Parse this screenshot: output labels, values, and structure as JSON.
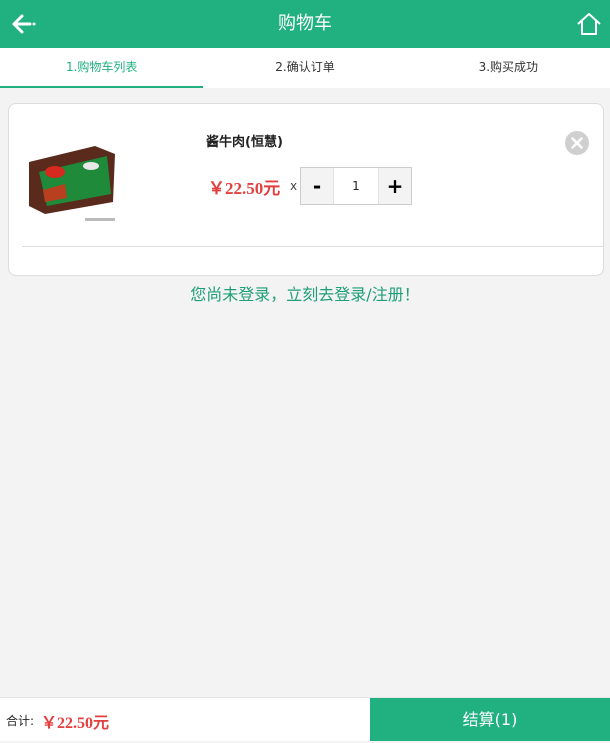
{
  "header": {
    "title": "购物车",
    "back_icon": "back-arrow-icon",
    "home_icon": "home-icon",
    "color": "#21b080"
  },
  "steps": [
    {
      "label": "1.购物车列表",
      "active": true
    },
    {
      "label": "2.确认订单",
      "active": false
    },
    {
      "label": "3.购买成功",
      "active": false
    }
  ],
  "cart_item": {
    "name": "酱牛肉(恒慧)",
    "price": "￥22.50元",
    "times": "x",
    "quantity": "1",
    "minus_label": "-",
    "plus_label": "+",
    "remove_icon": "close-circle-icon"
  },
  "login_prompt": "您尚未登录，立刻去登录/注册！",
  "footer": {
    "total_label": "合计:",
    "total_price": "￥22.50元",
    "checkout_label": "结算(1)"
  },
  "colors": {
    "accent": "#21b080",
    "price": "#e2403f",
    "background": "#f3f3f3"
  }
}
